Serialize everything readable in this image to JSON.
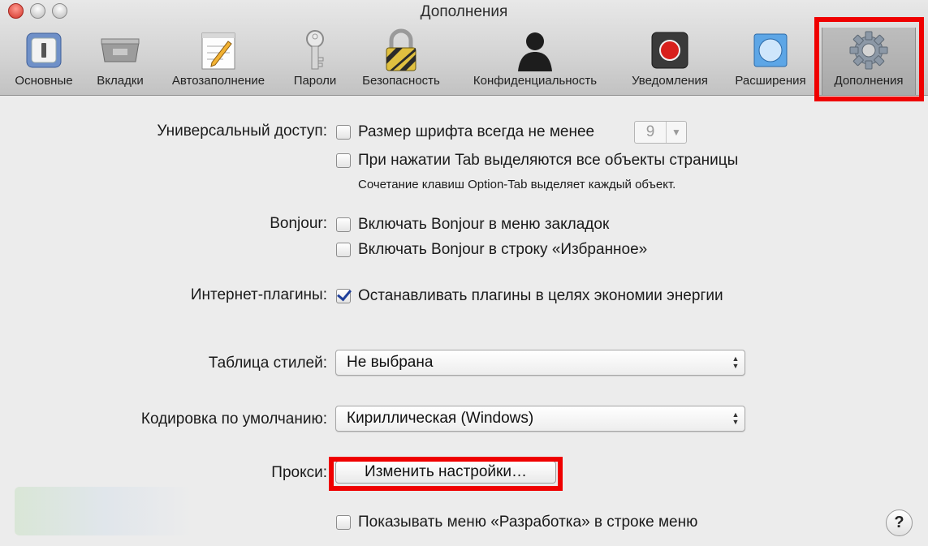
{
  "window": {
    "title": "Дополнения"
  },
  "toolbar": {
    "items": [
      {
        "id": "general",
        "label": "Основные",
        "icon": "switch-icon"
      },
      {
        "id": "tabs",
        "label": "Вкладки",
        "icon": "tabs-icon"
      },
      {
        "id": "autofill",
        "label": "Автозаполнение",
        "icon": "pencil-form-icon"
      },
      {
        "id": "passwords",
        "label": "Пароли",
        "icon": "key-icon"
      },
      {
        "id": "security",
        "label": "Безопасность",
        "icon": "lock-icon"
      },
      {
        "id": "privacy",
        "label": "Конфиденциальность",
        "icon": "silhouette-icon"
      },
      {
        "id": "notify",
        "label": "Уведомления",
        "icon": "record-icon"
      },
      {
        "id": "ext",
        "label": "Расширения",
        "icon": "puzzle-compass-icon"
      },
      {
        "id": "advanced",
        "label": "Дополнения",
        "icon": "gear-icon"
      }
    ],
    "active": "advanced"
  },
  "accessibility": {
    "label": "Универсальный доступ:",
    "min_font": {
      "label": "Размер шрифта всегда не менее",
      "checked": false,
      "value": "9"
    },
    "tab_highlight": {
      "label": "При нажатии Tab выделяются все объекты страницы",
      "checked": false
    },
    "note": "Сочетание клавиш Option-Tab выделяет каждый объект."
  },
  "bonjour": {
    "label": "Bonjour:",
    "bookmarks_menu": {
      "label": "Включать Bonjour в меню закладок",
      "checked": false
    },
    "favorites_bar": {
      "label": "Включать Bonjour в строку «Избранное»",
      "checked": false
    }
  },
  "plugins": {
    "label": "Интернет-плагины:",
    "stop_plugins": {
      "label": "Останавливать плагины в целях экономии энергии",
      "checked": true
    }
  },
  "stylesheet": {
    "label": "Таблица стилей:",
    "value": "Не выбрана"
  },
  "encoding": {
    "label": "Кодировка по умолчанию:",
    "value": "Кириллическая (Windows)"
  },
  "proxy": {
    "label": "Прокси:",
    "button": "Изменить настройки…"
  },
  "develop": {
    "label": "Показывать меню «Разработка» в строке меню",
    "checked": false
  },
  "help": {
    "glyph": "?"
  },
  "colors": {
    "highlight": "#ef0000",
    "check": "#1f3f9a"
  }
}
